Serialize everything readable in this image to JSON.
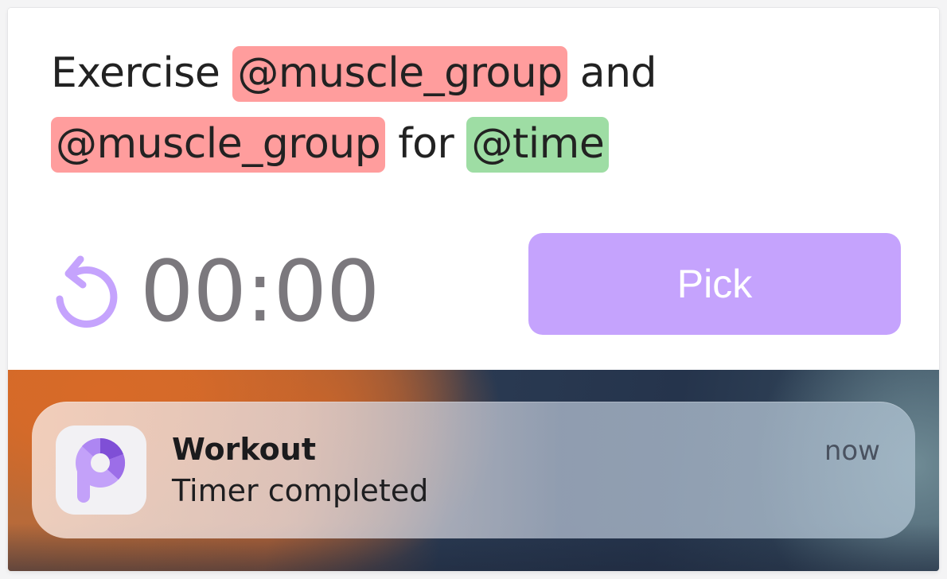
{
  "prompt": {
    "segments": [
      {
        "text": "Exercise ",
        "kind": "plain"
      },
      {
        "text": "@muscle_group",
        "kind": "token",
        "color": "#ff9d9d"
      },
      {
        "text": " and ",
        "kind": "plain"
      },
      {
        "text": "@muscle_group",
        "kind": "token",
        "color": "#ff9d9d"
      },
      {
        "text": " for ",
        "kind": "plain"
      },
      {
        "text": "@time",
        "kind": "token",
        "color": "#9edda4"
      }
    ]
  },
  "timer": {
    "display": "00:00",
    "reset_icon": "counterclockwise-arrow-icon",
    "icon_color": "#c5a3fd"
  },
  "actions": {
    "pick_label": "Pick",
    "pick_color": "#c5a3fd"
  },
  "notification": {
    "app_name": "Workout",
    "message": "Timer completed",
    "time": "now",
    "app_icon": "workout-app-p-icon"
  }
}
